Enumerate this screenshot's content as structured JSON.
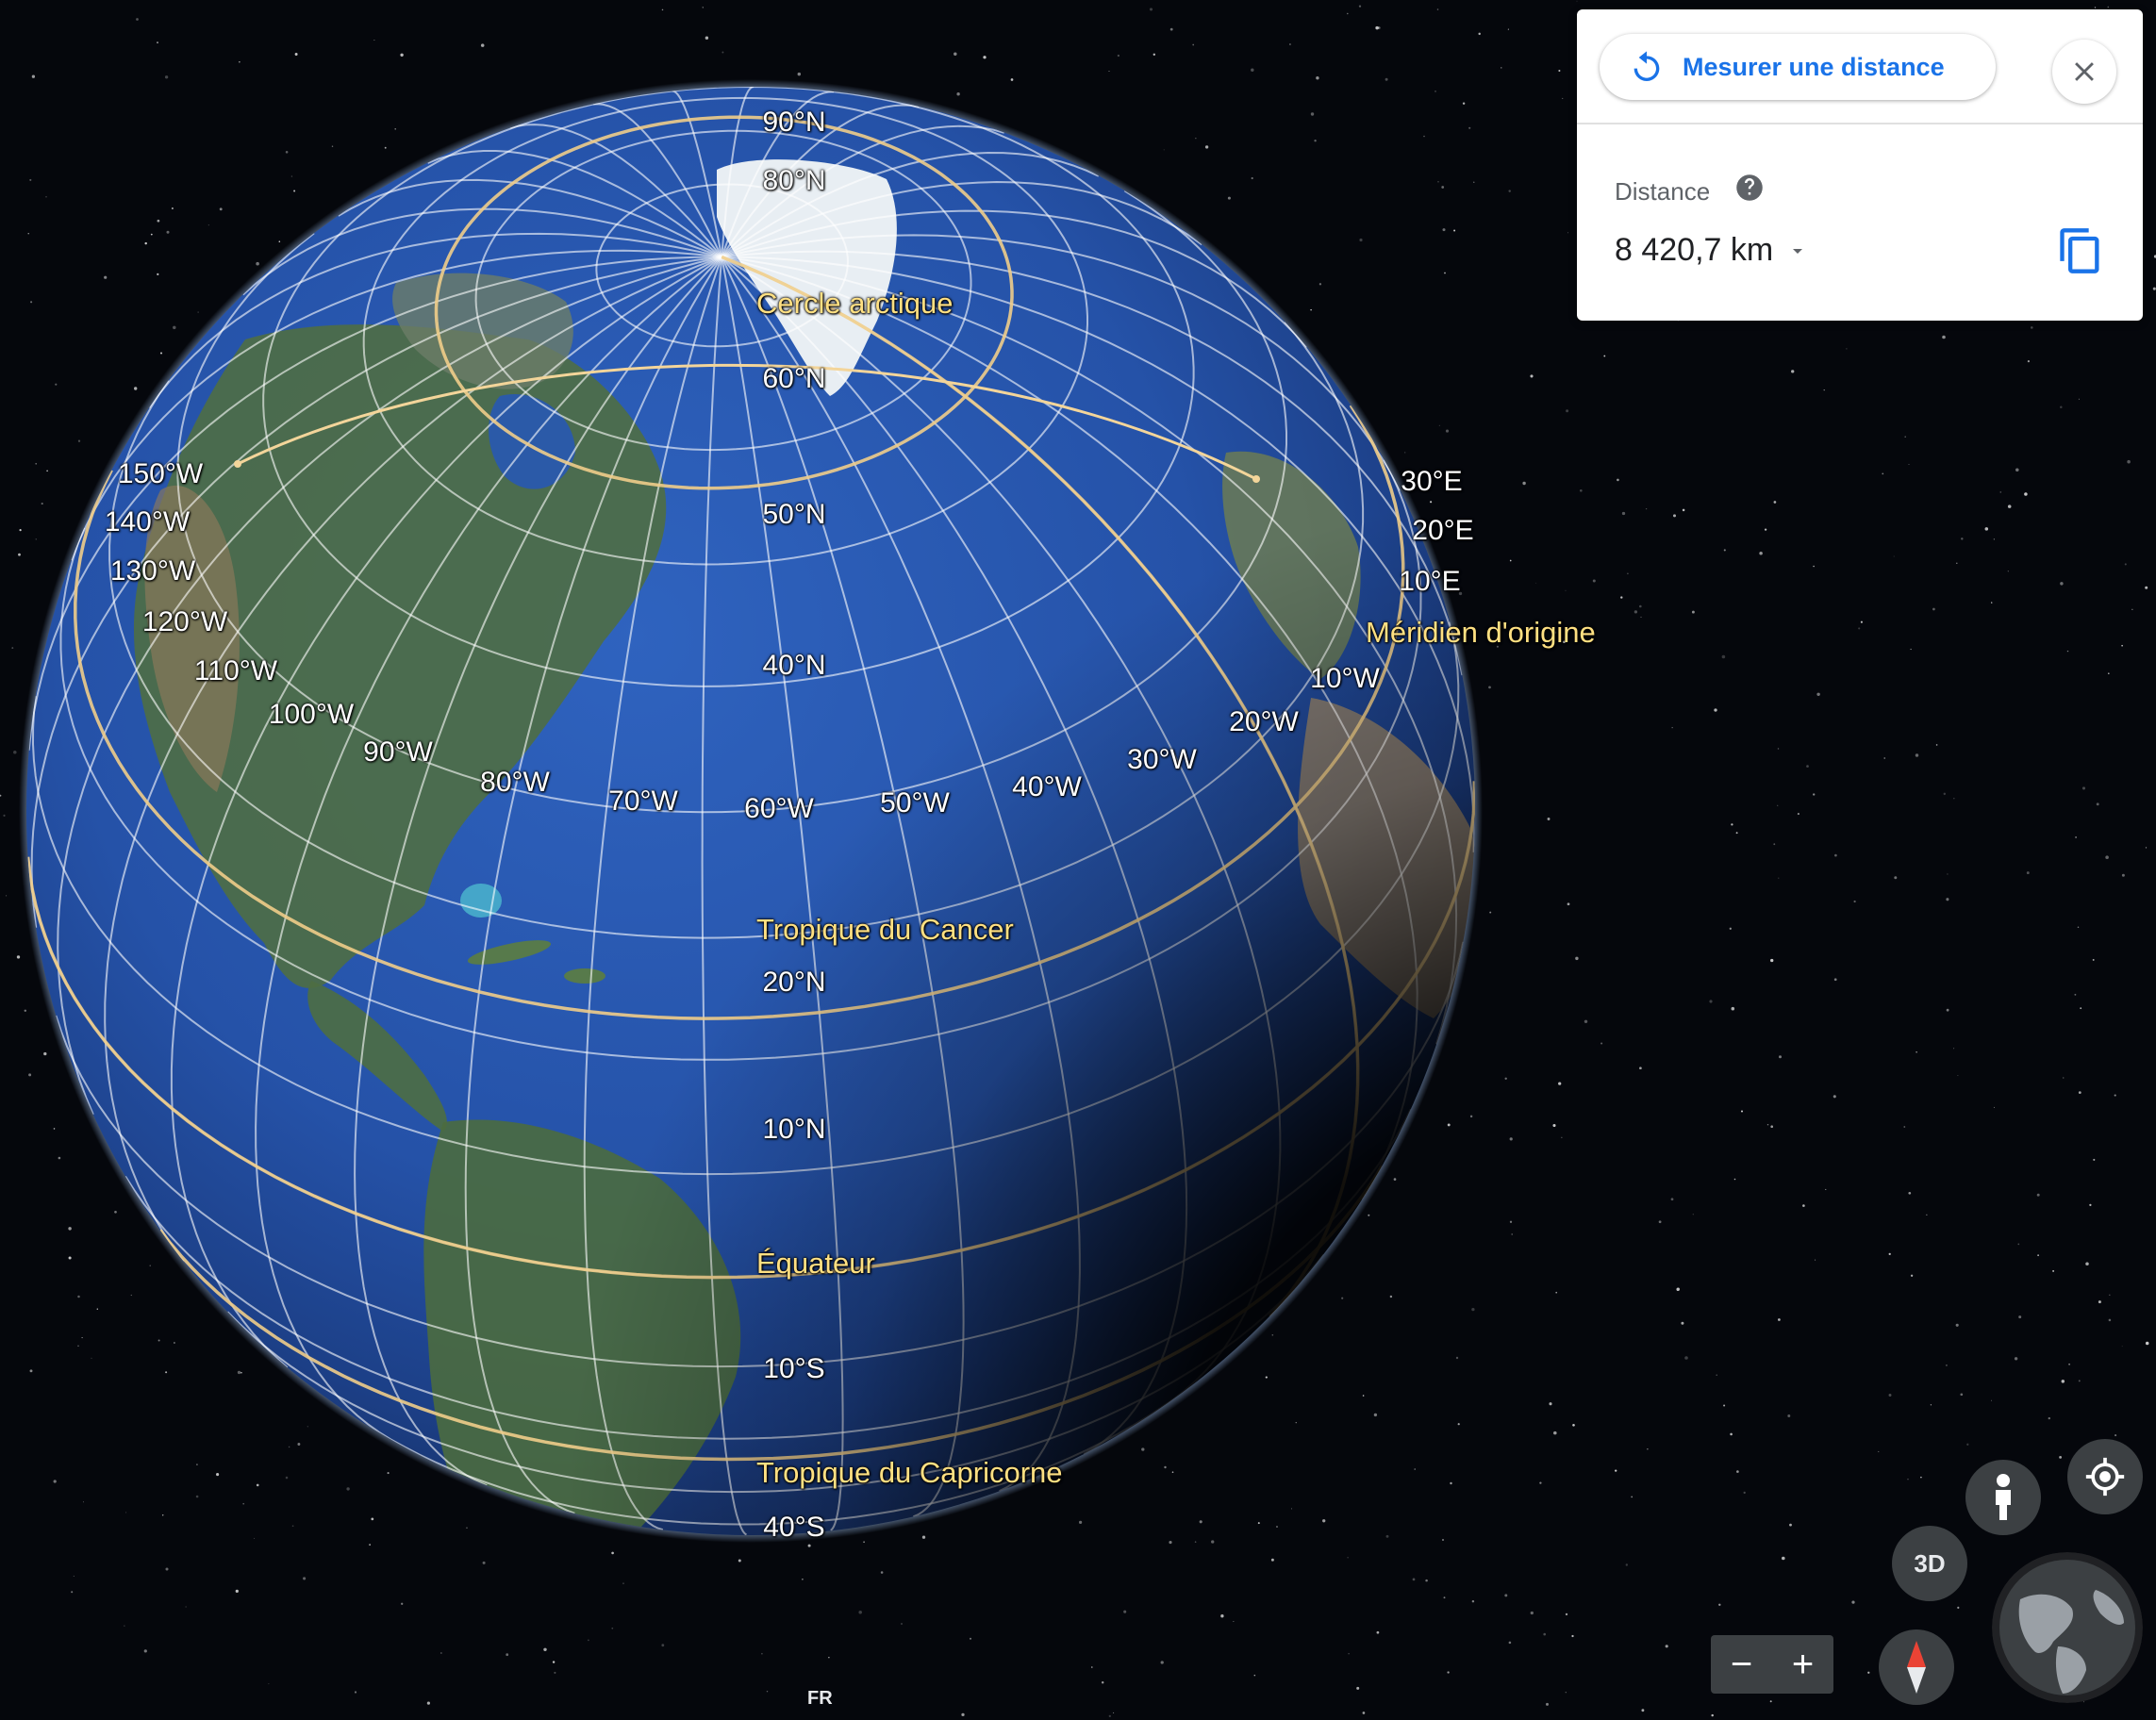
{
  "globe": {
    "colors": {
      "ocean": "#1f4fa8",
      "grid": "#ffffff",
      "special_lines": "#f0cd8a",
      "space": "#05070c"
    },
    "latitude_labels": [
      {
        "text": "90°N"
      },
      {
        "text": "80°N"
      },
      {
        "text": "60°N"
      },
      {
        "text": "50°N"
      },
      {
        "text": "40°N"
      },
      {
        "text": "20°N"
      },
      {
        "text": "10°N"
      },
      {
        "text": "10°S"
      },
      {
        "text": "40°S"
      }
    ],
    "longitude_labels": [
      {
        "text": "150°W"
      },
      {
        "text": "140°W"
      },
      {
        "text": "130°W"
      },
      {
        "text": "120°W"
      },
      {
        "text": "110°W"
      },
      {
        "text": "100°W"
      },
      {
        "text": "90°W"
      },
      {
        "text": "80°W"
      },
      {
        "text": "70°W"
      },
      {
        "text": "60°W"
      },
      {
        "text": "50°W"
      },
      {
        "text": "40°W"
      },
      {
        "text": "30°W"
      },
      {
        "text": "20°W"
      },
      {
        "text": "10°W"
      },
      {
        "text": "10°E"
      },
      {
        "text": "20°E"
      },
      {
        "text": "30°E"
      }
    ],
    "special_labels": {
      "arctic": "Cercle arctique",
      "prime_meridian": "Méridien d'origine",
      "cancer": "Tropique du Cancer",
      "equator": "Équateur",
      "capricorn": "Tropique du Capricorne"
    }
  },
  "measure_panel": {
    "button_label": "Mesurer une distance",
    "button_icon": "undo-icon",
    "close_icon": "close-icon",
    "distance_title": "Distance",
    "help_icon": "help-icon",
    "distance_value": "8 420,7 km",
    "copy_icon": "copy-icon",
    "accent_color": "#1a73e8"
  },
  "controls": {
    "pegman_icon": "pegman-icon",
    "locate_icon": "my-location-icon",
    "view_3d_label": "3D",
    "zoom_out_label": "−",
    "zoom_in_label": "+",
    "compass_icon": "compass-icon",
    "minimap_icon": "globe-minimap-icon"
  },
  "footer": {
    "language": "FR"
  }
}
